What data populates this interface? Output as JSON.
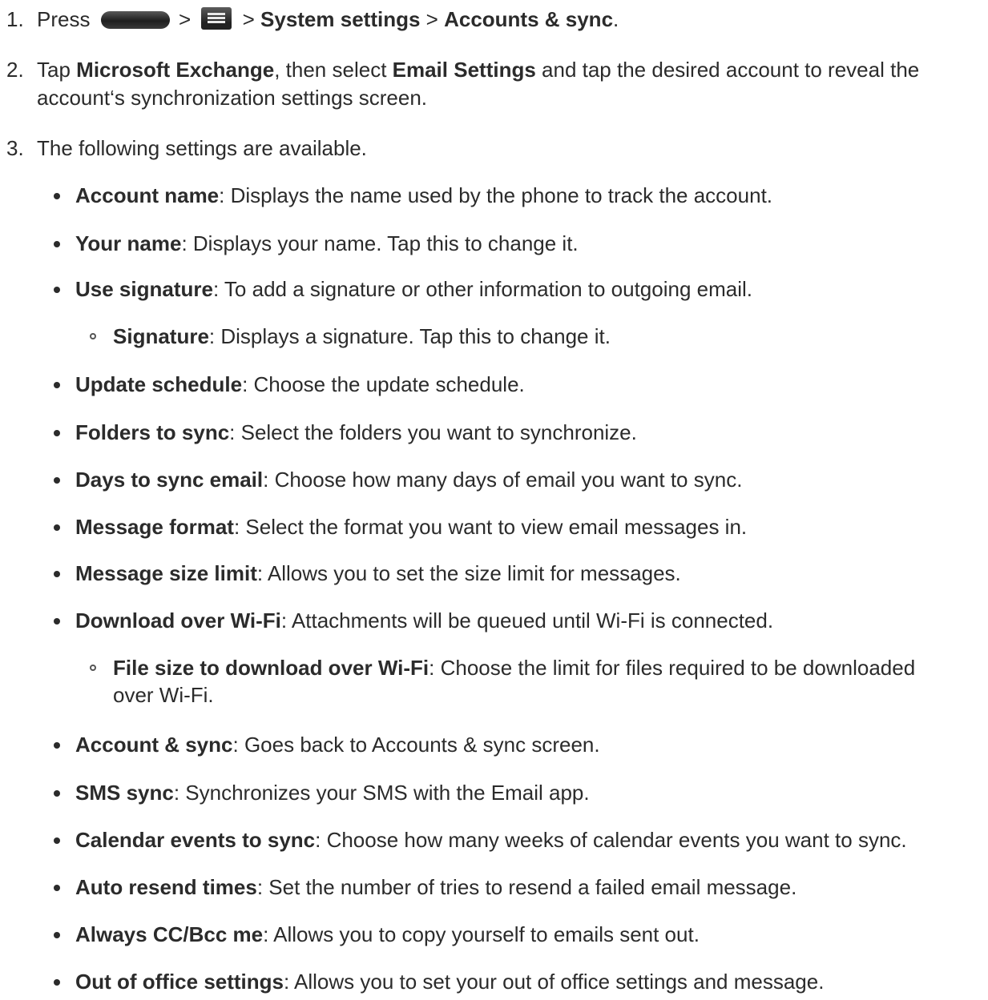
{
  "steps": [
    {
      "num": "1.",
      "press": "Press",
      "sep1": ">",
      "sep2": ">",
      "system_settings": "System settings",
      "sep3": ">",
      "accounts_sync": "Accounts & sync",
      "end": "."
    },
    {
      "num": "2.",
      "line1": {
        "t1": "Tap ",
        "b1": "Microsoft Exchange",
        "t2": ", then select ",
        "b2": "Email Settings",
        "t3": " and tap the desired account to reveal the"
      },
      "line2": "account‘s synchronization settings screen."
    },
    {
      "num": "3.",
      "text": "The following settings are available."
    }
  ],
  "settings": [
    {
      "label": "Account name",
      "desc": ": Displays the name used by the phone to track the account."
    },
    {
      "label": "Your name",
      "desc": ": Displays your name. Tap this to change it."
    },
    {
      "label": "Use signature",
      "desc": ": To add a signature or other information to outgoing email."
    },
    {
      "label": "Signature",
      "desc": ": Displays a signature. Tap this to change it."
    },
    {
      "label": "Update schedule",
      "desc": ": Choose the update schedule."
    },
    {
      "label": "Folders to sync",
      "desc": ": Select the folders you want to synchronize."
    },
    {
      "label": "Days to sync email",
      "desc": ": Choose how many days of email you want to sync."
    },
    {
      "label": "Message format",
      "desc": ": Select the format you want to view email messages in."
    },
    {
      "label": "Message size limit",
      "desc": ": Allows you to set the size limit for messages."
    },
    {
      "label": "Download over Wi-Fi",
      "desc": ": Attachments will be queued until Wi-Fi is connected."
    },
    {
      "label": "File size to download over Wi-Fi",
      "desc": ": Choose the limit for files required to be downloaded",
      "desc2": "over Wi-Fi."
    },
    {
      "label": "Account & sync",
      "desc": ": Goes back to Accounts & sync screen."
    },
    {
      "label": "SMS sync",
      "desc": ": Synchronizes your SMS with the Email app."
    },
    {
      "label": "Calendar events to sync",
      "desc": ": Choose how many weeks of calendar events you want to sync."
    },
    {
      "label": "Auto resend times",
      "desc": ": Set the number of tries to resend a failed email message."
    },
    {
      "label": "Always CC/Bcc me",
      "desc": ": Allows you to copy yourself to emails sent out."
    },
    {
      "label": "Out of office settings",
      "desc": ": Allows you to set your out of office settings and message."
    }
  ]
}
